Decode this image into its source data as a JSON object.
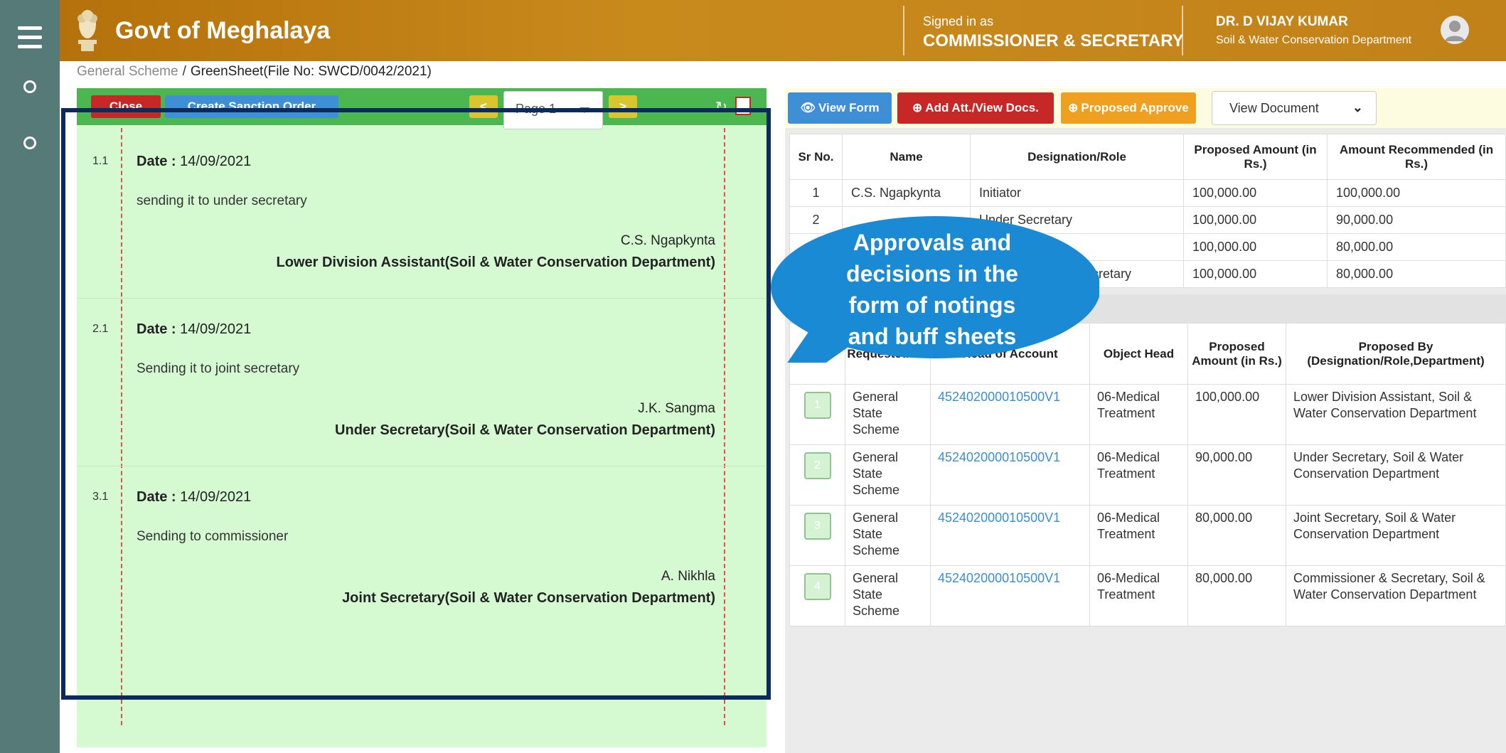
{
  "rail": {
    "menu_icon": "hamburger-menu-icon",
    "items": [
      "circle-icon",
      "circle-icon"
    ]
  },
  "header": {
    "brand": "Govt of Meghalaya",
    "emblem_icon": "state-emblem-icon",
    "signed_in_label": "Signed in as",
    "signed_in_role": "COMMISSIONER & SECRETARY",
    "user_name": "DR. D VIJAY KUMAR",
    "user_department": "Soil & Water Conservation Department",
    "avatar_icon": "user-avatar-icon"
  },
  "breadcrumb": {
    "parent": "General Scheme",
    "separator": "/",
    "current": "GreenSheet(File No: SWCD/0042/2021)"
  },
  "notesheet": {
    "toolbar": {
      "close_label": "Close",
      "sanction_label": "Create Sanction Order",
      "prev_label": "<",
      "next_label": ">",
      "page_label": "Page 1"
    },
    "notes": [
      {
        "num": "1.1",
        "date_label": "Date :",
        "date": "14/09/2021",
        "text": "sending it to under secretary",
        "signer": "C.S. Ngapkynta",
        "designation": "Lower Division Assistant(Soil & Water Conservation Department)"
      },
      {
        "num": "2.1",
        "date_label": "Date :",
        "date": "14/09/2021",
        "text": "Sending it to joint secretary",
        "signer": "J.K. Sangma",
        "designation": "Under Secretary(Soil & Water Conservation Department)"
      },
      {
        "num": "3.1",
        "date_label": "Date :",
        "date": "14/09/2021",
        "text": "Sending to commissioner",
        "signer": "A. Nikhla",
        "designation": "Joint Secretary(Soil & Water Conservation Department)"
      }
    ]
  },
  "right": {
    "toolbar": {
      "view_form": "View Form",
      "add_docs": "Add Att./View Docs.",
      "proposed_approve": "Proposed Approve",
      "doc_select": "View Document"
    },
    "approvals_table": {
      "headers": [
        "Sr No.",
        "Name",
        "Designation/Role",
        "Proposed Amount (in Rs.)",
        "Amount Recommended (in Rs.)"
      ],
      "rows": [
        [
          "1",
          "C.S. Ngapkynta",
          "Initiator",
          "100,000.00",
          "100,000.00"
        ],
        [
          "2",
          "",
          "Under Secretary",
          "100,000.00",
          "90,000.00"
        ],
        [
          "3",
          "",
          "",
          "100,000.00",
          "80,000.00"
        ],
        [
          "4",
          "",
          "Commissioner & Secretary",
          "100,000.00",
          "80,000.00"
        ]
      ]
    },
    "heads_table": {
      "headers": [
        "",
        "Requested for",
        "Head of Account",
        "Object Head",
        "Proposed Amount (in Rs.)",
        "Proposed By (Designation/Role,Department)"
      ],
      "rows": [
        {
          "n": "1",
          "for": "General State Scheme",
          "head": "452402000010500V1",
          "object": "06-Medical Treatment",
          "amount": "100,000.00",
          "by": "Lower Division Assistant, Soil & Water Conservation Department"
        },
        {
          "n": "2",
          "for": "General State Scheme",
          "head": "452402000010500V1",
          "object": "06-Medical Treatment",
          "amount": "90,000.00",
          "by": "Under Secretary, Soil & Water Conservation Department"
        },
        {
          "n": "3",
          "for": "General State Scheme",
          "head": "452402000010500V1",
          "object": "06-Medical Treatment",
          "amount": "80,000.00",
          "by": "Joint Secretary, Soil & Water Conservation Department"
        },
        {
          "n": "4",
          "for": "General State Scheme",
          "head": "452402000010500V1",
          "object": "06-Medical Treatment",
          "amount": "80,000.00",
          "by": "Commissioner & Secretary, Soil & Water Conservation Department"
        }
      ]
    }
  },
  "callout": {
    "lines": [
      "Approvals and",
      "decisions in the",
      "form of notings",
      "and buff sheets"
    ],
    "color": "#1a8ad4"
  },
  "colors": {
    "header": "#c2821a",
    "rail": "#557a78",
    "notesheet": "#d5fad2",
    "toolbar_green": "#4cb651",
    "highlight": "#0d2a5c"
  }
}
